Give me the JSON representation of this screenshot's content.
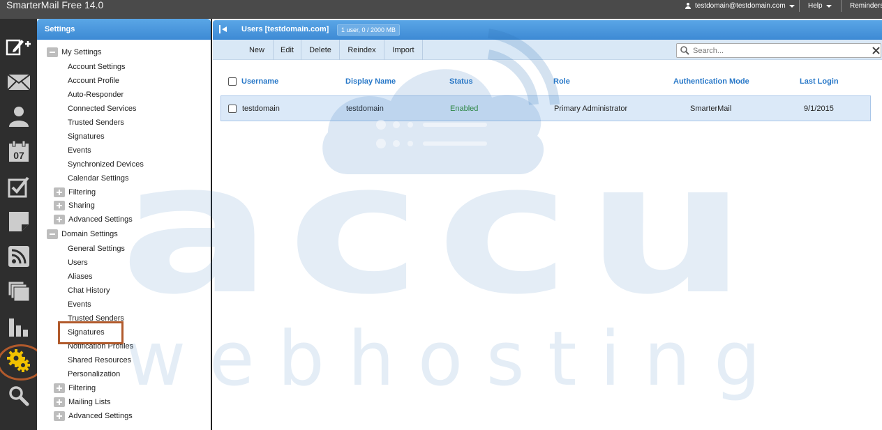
{
  "app": {
    "title": "SmarterMail Free 14.0"
  },
  "topbar": {
    "user": "testdomain@testdomain.com",
    "help": "Help",
    "reminders": "Reminders"
  },
  "nav_icons": [
    "compose-icon",
    "mail-icon",
    "contacts-icon",
    "calendar-icon",
    "tasks-icon",
    "notes-icon",
    "rss-icon",
    "files-icon",
    "reports-icon",
    "settings-icon",
    "search-icon"
  ],
  "calendar_day": "07",
  "tree": {
    "header": "Settings",
    "my_settings": {
      "label": "My Settings",
      "items": [
        "Account Settings",
        "Account Profile",
        "Auto-Responder",
        "Connected Services",
        "Trusted Senders",
        "Signatures",
        "Events",
        "Synchronized Devices",
        "Calendar Settings"
      ],
      "groups": [
        "Filtering",
        "Sharing",
        "Advanced Settings"
      ]
    },
    "domain_settings": {
      "label": "Domain Settings",
      "items": [
        "General Settings",
        "Users",
        "Aliases",
        "Chat History",
        "Events",
        "Trusted Senders",
        "Signatures",
        "Notification Profiles",
        "Shared Resources",
        "Personalization"
      ],
      "groups": [
        "Filtering",
        "Mailing Lists",
        "Advanced Settings"
      ]
    }
  },
  "main": {
    "title": "Users [testdomain.com]",
    "badge": "1 user, 0 / 2000 MB",
    "toolbar": {
      "new": "New",
      "edit": "Edit",
      "delete": "Delete",
      "reindex": "Reindex",
      "import": "Import"
    },
    "search": {
      "placeholder": "Search...",
      "value": ""
    },
    "columns": [
      "Username",
      "Display Name",
      "Status",
      "Role",
      "Authentication Mode",
      "Last Login"
    ],
    "rows": [
      [
        "testdomain",
        "testdomain",
        "Enabled",
        "Primary Administrator",
        "SmarterMail",
        "9/1/2015"
      ]
    ]
  },
  "watermark": {
    "word1": "accu",
    "word2": "w e b   h o s t i n g"
  },
  "colors": {
    "header_blue": "#3d8ad4",
    "toolbar": "#d9e8f6",
    "highlight": "#b15a2c",
    "status_enabled": "#2b8a2b",
    "settings_icon": "#f2c200"
  }
}
